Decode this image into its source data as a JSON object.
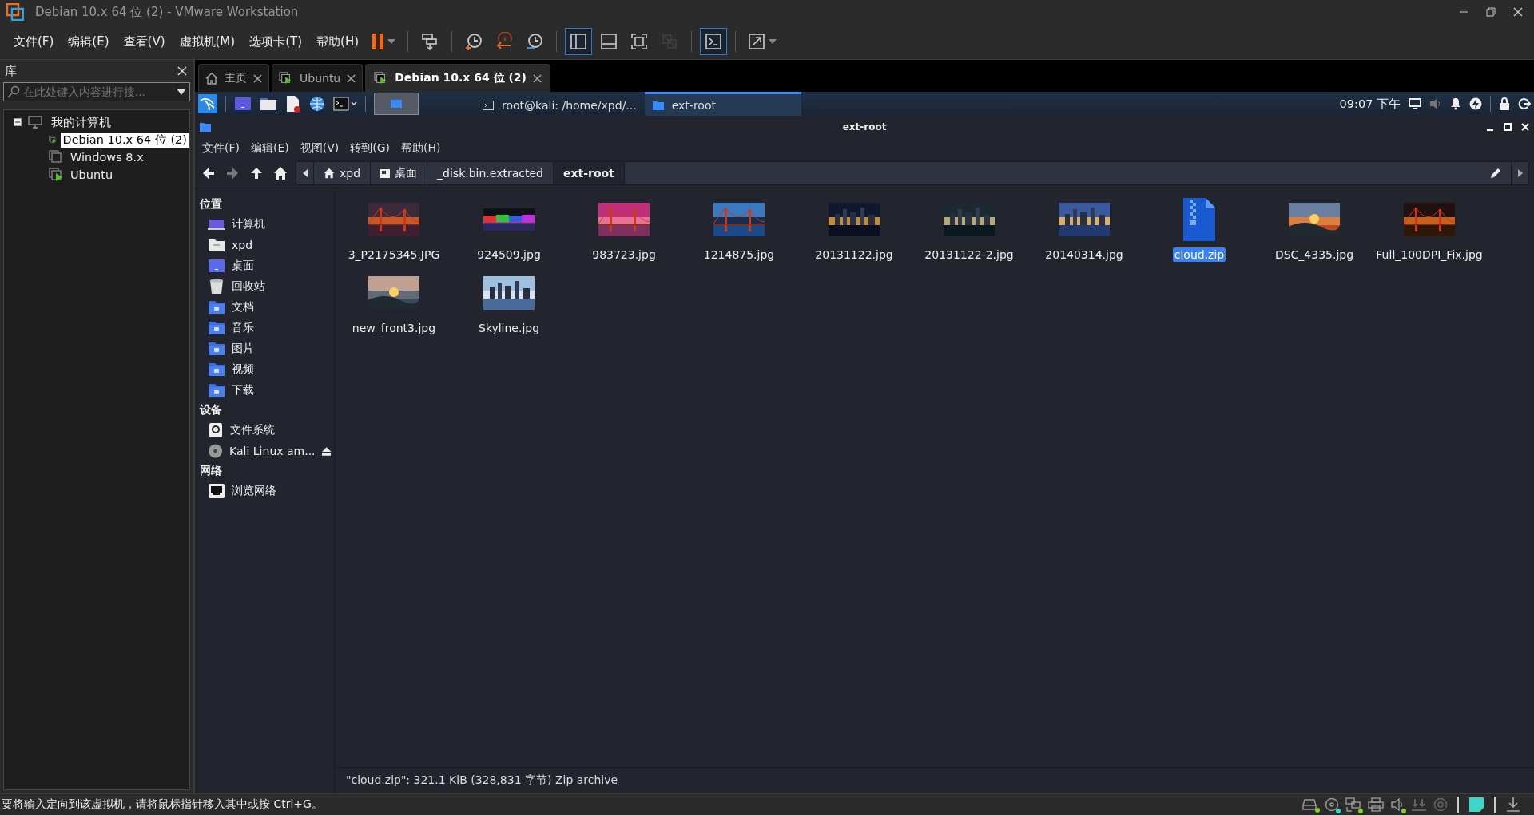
{
  "window": {
    "title": "Debian 10.x 64 位 (2) - VMware Workstation"
  },
  "menu": [
    "文件(F)",
    "编辑(E)",
    "查看(V)",
    "虚拟机(M)",
    "选项卡(T)",
    "帮助(H)"
  ],
  "toolbar": [
    {
      "kind": "pause",
      "selected": false,
      "disabled": false
    },
    {
      "kind": "send-keys",
      "selected": false,
      "disabled": false
    },
    {
      "kind": "snapshot",
      "selected": false,
      "disabled": false
    },
    {
      "kind": "revert",
      "selected": false,
      "disabled": false
    },
    {
      "kind": "snapshot-manager",
      "selected": false,
      "disabled": false
    },
    {
      "kind": "sidebar-view",
      "selected": true,
      "disabled": false
    },
    {
      "kind": "thumbnail-view",
      "selected": false,
      "disabled": false
    },
    {
      "kind": "fullscreen",
      "selected": false,
      "disabled": false
    },
    {
      "kind": "unity",
      "selected": false,
      "disabled": true
    },
    {
      "kind": "console",
      "selected": true,
      "disabled": false
    },
    {
      "kind": "stretch",
      "selected": false,
      "disabled": false
    }
  ],
  "library": {
    "title": "库",
    "search_placeholder": "在此处键入内容进行搜...",
    "tree": [
      {
        "label": "我的计算机",
        "expanded": true,
        "children": [
          {
            "label": "Debian 10.x 64 位 (2)",
            "selected": true,
            "running": true
          },
          {
            "label": "Windows 8.x",
            "selected": false,
            "running": false
          },
          {
            "label": "Ubuntu",
            "selected": false,
            "running": true
          }
        ]
      }
    ]
  },
  "tabs": [
    {
      "label": "主页",
      "kind": "home",
      "selected": false
    },
    {
      "label": "Ubuntu",
      "kind": "vm",
      "selected": false
    },
    {
      "label": "Debian 10.x 64 位 (2)",
      "kind": "vm",
      "selected": true
    }
  ],
  "guest": {
    "panel": {
      "tasks": [
        {
          "label": "root@kali: /home/xpd/...",
          "kind": "terminal",
          "selected": false
        },
        {
          "label": "ext-root",
          "kind": "folder",
          "selected": true
        }
      ],
      "clock": "09:07 下午"
    },
    "file_manager": {
      "title": "ext-root",
      "menu": [
        "文件(F)",
        "编辑(E)",
        "视图(V)",
        "转到(G)",
        "帮助(H)"
      ],
      "nav": [
        {
          "kind": "back",
          "disabled": false
        },
        {
          "kind": "forward",
          "disabled": true
        },
        {
          "kind": "up",
          "disabled": false
        },
        {
          "kind": "home",
          "disabled": false
        }
      ],
      "path": [
        {
          "label": "xpd",
          "kind": "home",
          "selected": false
        },
        {
          "label": "桌面",
          "kind": "desktop",
          "selected": false
        },
        {
          "label": "_disk.bin.extracted",
          "kind": "folder",
          "selected": false
        },
        {
          "label": "ext-root",
          "kind": "folder",
          "selected": true
        }
      ],
      "sidebar": [
        {
          "heading": "位置",
          "items": [
            {
              "label": "计算机",
              "kind": "computer"
            },
            {
              "label": "xpd",
              "kind": "home"
            },
            {
              "label": "桌面",
              "kind": "desktop"
            },
            {
              "label": "回收站",
              "kind": "trash"
            },
            {
              "label": "文档",
              "kind": "documents"
            },
            {
              "label": "音乐",
              "kind": "music"
            },
            {
              "label": "图片",
              "kind": "pictures"
            },
            {
              "label": "视频",
              "kind": "videos"
            },
            {
              "label": "下载",
              "kind": "downloads"
            }
          ]
        },
        {
          "heading": "设备",
          "items": [
            {
              "label": "文件系统",
              "kind": "drive"
            },
            {
              "label": "Kali Linux am...",
              "kind": "disc"
            }
          ]
        },
        {
          "heading": "网络",
          "items": [
            {
              "label": "浏览网络",
              "kind": "network"
            }
          ]
        }
      ],
      "files": [
        {
          "name": "3_P2175345.JPG",
          "kind": "picture",
          "selected": false
        },
        {
          "name": "924509.jpg",
          "kind": "picture",
          "selected": false
        },
        {
          "name": "983723.jpg",
          "kind": "picture",
          "selected": false
        },
        {
          "name": "1214875.jpg",
          "kind": "picture",
          "selected": false
        },
        {
          "name": "20131122.jpg",
          "kind": "picture",
          "selected": false
        },
        {
          "name": "20131122-2.jpg",
          "kind": "picture",
          "selected": false
        },
        {
          "name": "20140314.jpg",
          "kind": "picture",
          "selected": false
        },
        {
          "name": "cloud.zip",
          "kind": "zip",
          "selected": true
        },
        {
          "name": "DSC_4335.jpg",
          "kind": "picture",
          "selected": false
        },
        {
          "name": "Full_100DPI_Fix.jpg",
          "kind": "picture",
          "selected": false
        },
        {
          "name": "new_front3.jpg",
          "kind": "picture",
          "selected": false
        },
        {
          "name": "Skyline.jpg",
          "kind": "picture",
          "selected": false
        }
      ],
      "status": "\"cloud.zip\": 321.1 KiB (328,831 字节) Zip archive"
    }
  },
  "status_bar": {
    "message": "要将输入定向到该虚拟机，请将鼠标指针移入其中或按 Ctrl+G。",
    "devices": [
      {
        "kind": "disk",
        "color": "#7ed321"
      },
      {
        "kind": "cd",
        "color": "#33d6d0"
      },
      {
        "kind": "network",
        "color": "#7ed321"
      },
      {
        "kind": "printer"
      },
      {
        "kind": "sound",
        "color": "#7ed321"
      },
      {
        "kind": "usb"
      },
      {
        "kind": "camera"
      },
      {
        "kind": "note"
      },
      {
        "kind": "download"
      }
    ]
  }
}
